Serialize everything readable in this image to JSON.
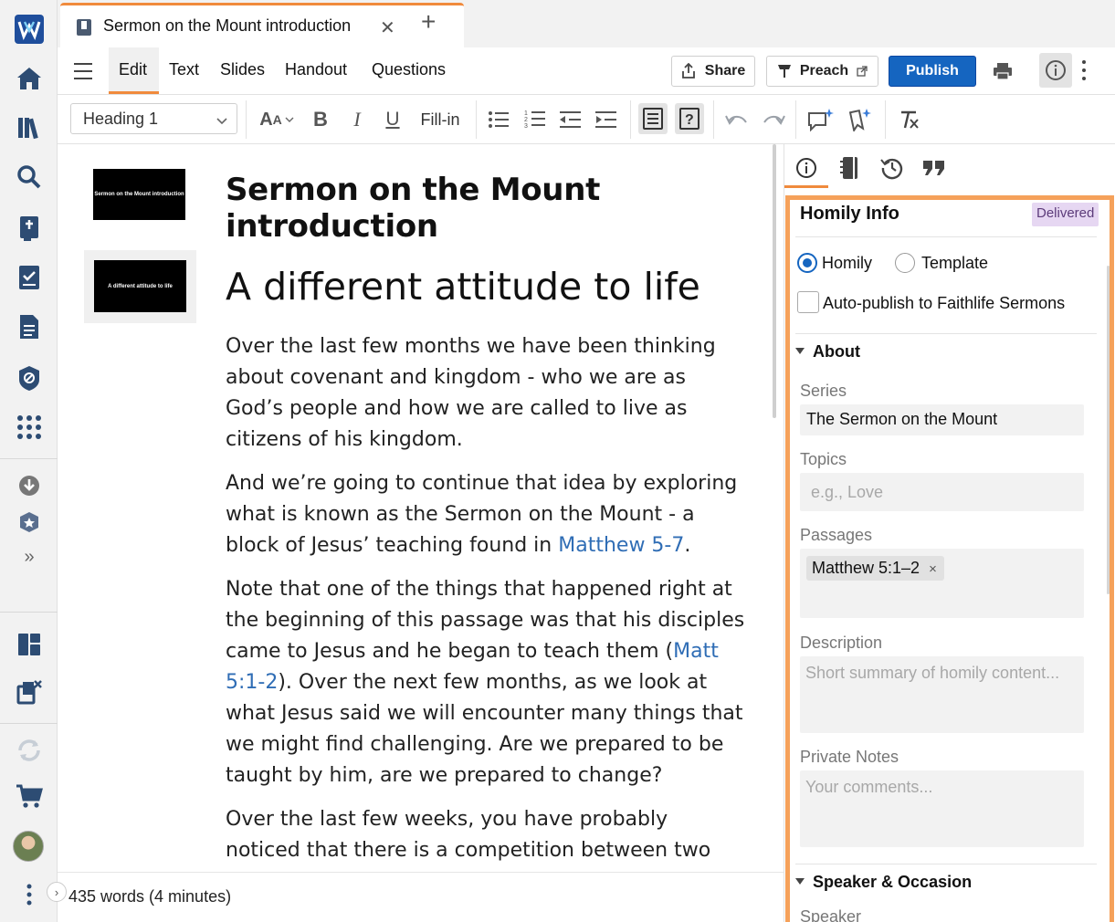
{
  "tab": {
    "title": "Sermon on the Mount introduction",
    "close": "✕",
    "add": "+"
  },
  "modes": [
    "Edit",
    "Text",
    "Slides",
    "Handout",
    "Questions"
  ],
  "actions": {
    "share": "Share",
    "preach": "Preach",
    "publish": "Publish"
  },
  "format": {
    "style": "Heading 1",
    "fill_in": "Fill-in"
  },
  "thumbnails": [
    "Sermon on the Mount introduction",
    "A different attitude to life"
  ],
  "doc": {
    "title": "Sermon on the Mount introduction",
    "heading": "A different attitude to life",
    "p1": "Over the last few months we have been thinking about covenant and kingdom - who we are as God’s people and how we are called to live as citizens of his kingdom.",
    "p2_a": "And we’re going to continue that idea by exploring what is known as the Sermon on the Mount - a block of Jesus’ teaching found in ",
    "p2_ref": "Matthew 5-7",
    "p2_b": ".",
    "p3_a": "Note that one of the things that happened right at the beginning of this passage was that his disciples came to Jesus and he began to teach them (",
    "p3_ref": "Matt 5:1-2",
    "p3_b": "). Over the next few months, as we look at what Jesus said we will encounter many things that we might find challenging. Are we prepared to be taught by him, are we prepared to change?",
    "p4": "Over the last few weeks, you have probably noticed that there is a competition between two people to"
  },
  "status": {
    "words": "435 words (4 minutes)"
  },
  "panel": {
    "title": "Homily Info",
    "badge": "Delivered",
    "radio_homily": "Homily",
    "radio_template": "Template",
    "autopublish": "Auto-publish to Faithlife Sermons",
    "about": "About",
    "series_label": "Series",
    "series_value": "The Sermon on the Mount",
    "topics_label": "Topics",
    "topics_placeholder": "e.g., Love",
    "passages_label": "Passages",
    "passage_chip": "Matthew 5:1–2",
    "chip_remove": "×",
    "description_label": "Description",
    "description_placeholder": "Short summary of homily content...",
    "notes_label": "Private Notes",
    "notes_placeholder": "Your comments...",
    "speaker_section": "Speaker & Occasion",
    "speaker_label": "Speaker"
  },
  "colors": {
    "accent": "#f08a3c",
    "publish": "#1565c0",
    "link": "#2f6db5",
    "highlight": "#f5a15a",
    "badge": "#e6d7f2"
  }
}
